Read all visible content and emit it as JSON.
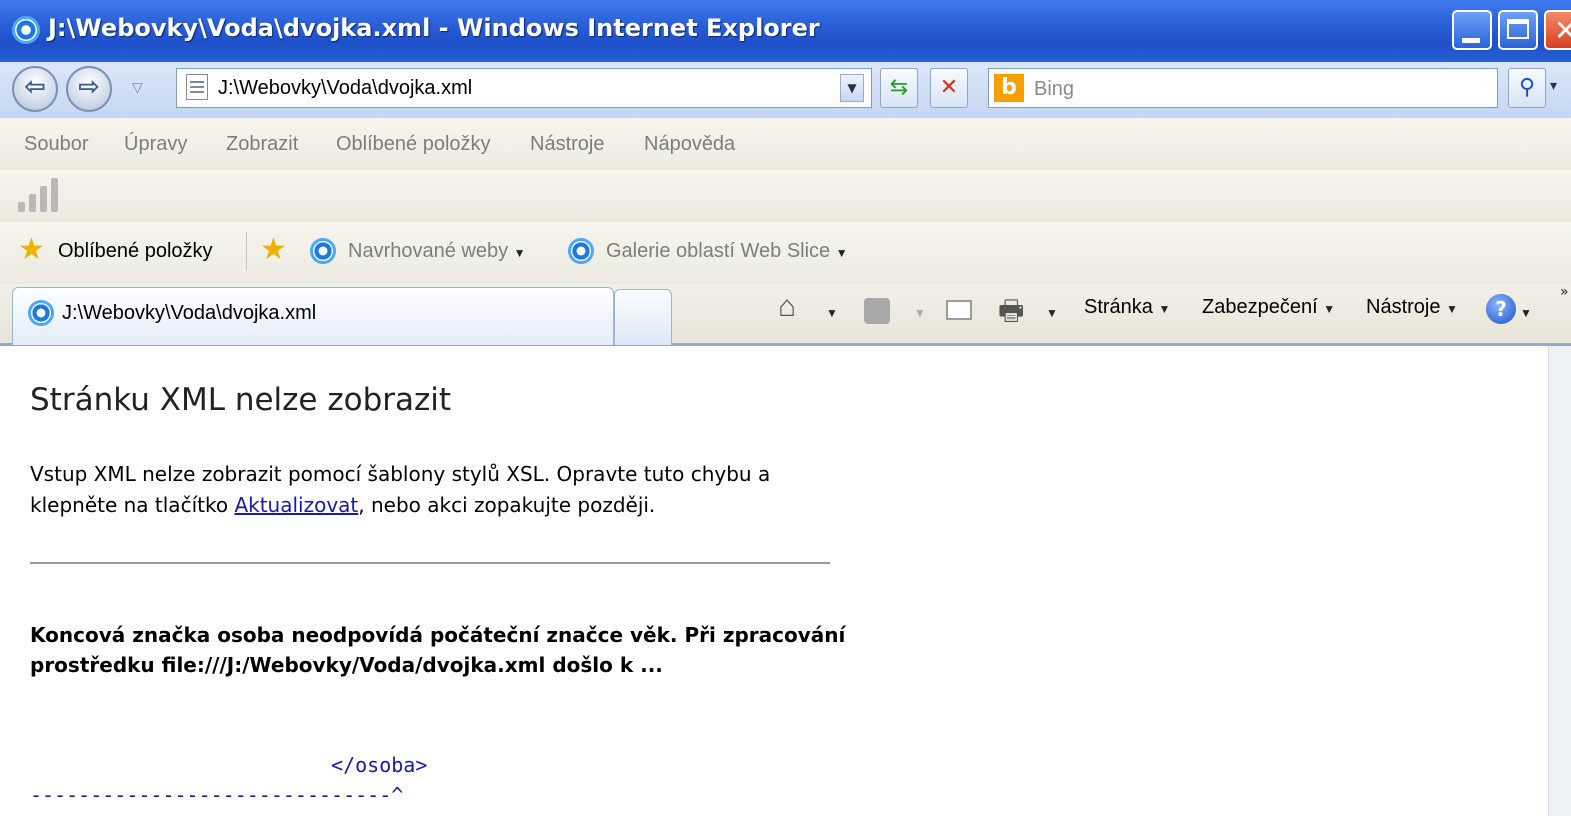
{
  "window": {
    "title": "J:\\Webovky\\Voda\\dvojka.xml - Windows Internet Explorer"
  },
  "address_bar": {
    "url": "J:\\Webovky\\Voda\\dvojka.xml",
    "search_provider": "Bing",
    "search_placeholder": "Bing"
  },
  "menu": {
    "items": [
      "Soubor",
      "Úpravy",
      "Zobrazit",
      "Oblíbené položky",
      "Nástroje",
      "Nápověda"
    ]
  },
  "favorites_bar": {
    "favorites_label": "Oblíbené položky",
    "suggested_sites": "Navrhované weby",
    "web_slice_gallery": "Galerie oblastí Web Slice"
  },
  "tabs": {
    "active_label": "J:\\Webovky\\Voda\\dvojka.xml"
  },
  "command_bar": {
    "page": "Stránka",
    "security": "Zabezpečení",
    "tools": "Nástroje"
  },
  "content": {
    "title": "Stránku XML nelze zobrazit",
    "desc_part1": "Vstup XML nelze zobrazit pomocí šablony stylů XSL. Opravte tuto chybu a klepněte na tlačítko ",
    "refresh_link": "Aktualizovat",
    "desc_part2": ", nebo akci zopakujte později.",
    "error_detail": "Koncová značka osoba neodpovídá počáteční značce věk. Při zpracování prostředku file:///J:/Webovky/Voda/dvojka.xml došlo k ...",
    "source_line": "                         </osoba>",
    "source_pointer": "------------------------------^"
  },
  "colors": {
    "titlebar": "#2a5fd8",
    "link": "#1a1aa6",
    "menu_text": "#7d7d7d"
  }
}
